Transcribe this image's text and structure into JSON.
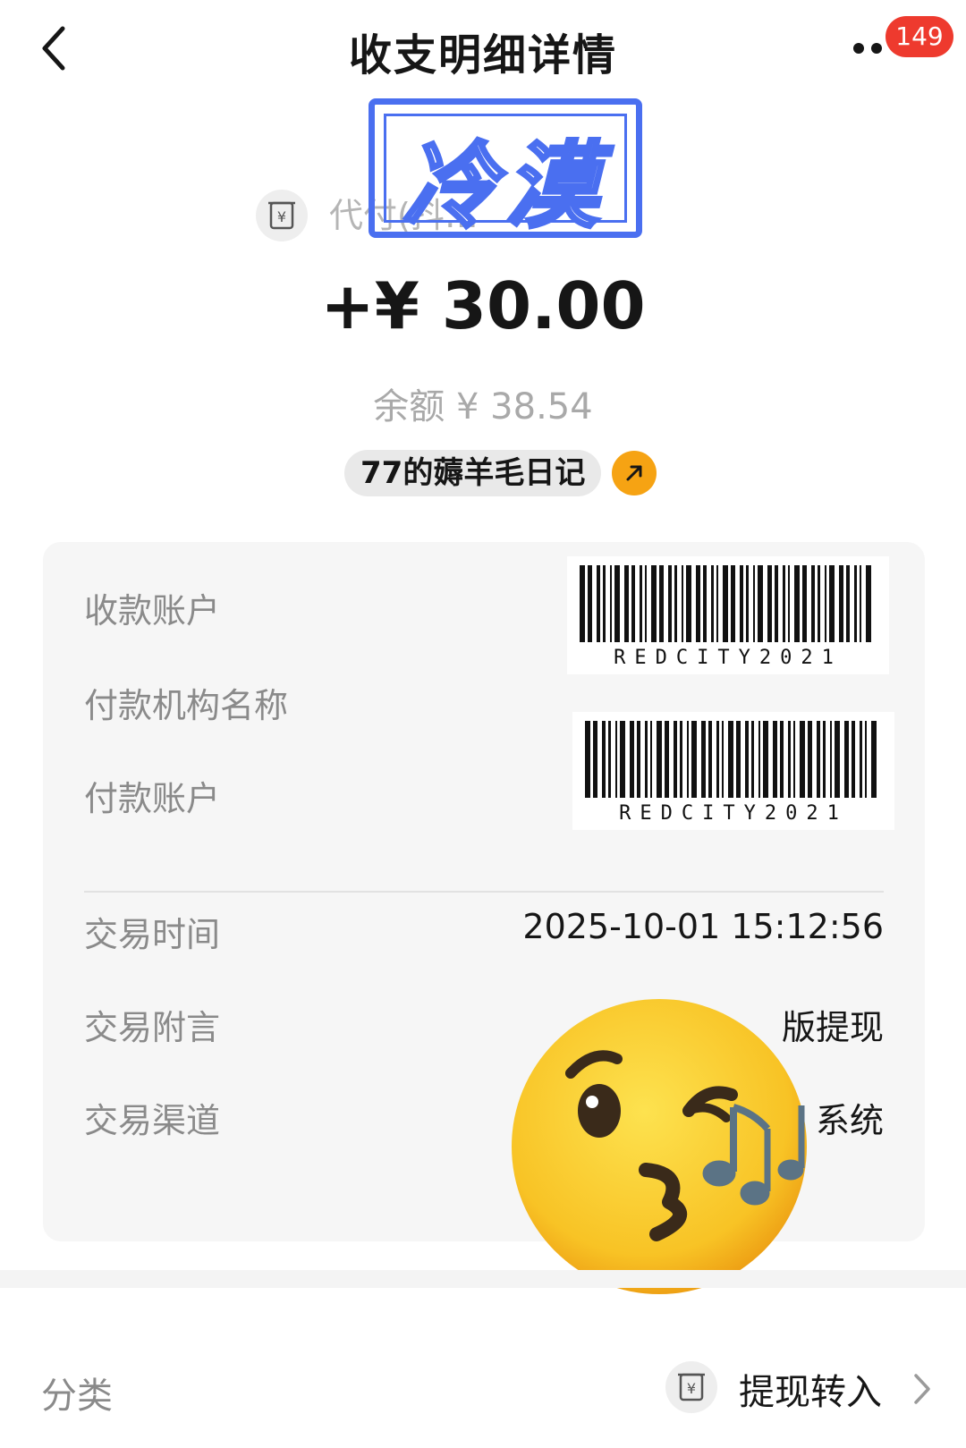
{
  "header": {
    "title": "收支明细详情",
    "back_icon": "chevron-left-icon",
    "more_icon": "more-dots-icon",
    "notification_count": "149"
  },
  "stamp": {
    "text": "冷漠"
  },
  "merchant": {
    "name": "代付(抖…"
  },
  "amount": "+¥ 30.00",
  "balance": "余额 ¥ 38.54",
  "tag": {
    "label": "77的薅羊毛日记",
    "arrow_icon": "arrow-up-right-icon"
  },
  "details": {
    "payee_account": {
      "label": "收款账户",
      "barcode_text": "REDCITY2021"
    },
    "payer_org": {
      "label": "付款机构名称"
    },
    "payer_account": {
      "label": "付款账户",
      "barcode_text": "REDCITY2021"
    },
    "trade_time": {
      "label": "交易时间",
      "value": "2025-10-01 15:12:56"
    },
    "trade_note": {
      "label": "交易附言",
      "value": "版提现"
    },
    "trade_channel": {
      "label": "交易渠道",
      "value": "系统"
    }
  },
  "category": {
    "label": "分类",
    "value": "提现转入",
    "chevron_icon": "chevron-right-icon"
  },
  "colors": {
    "accent_orange": "#f6a313",
    "badge_red": "#ee3a2e",
    "stamp_blue": "#4a6ff0"
  }
}
